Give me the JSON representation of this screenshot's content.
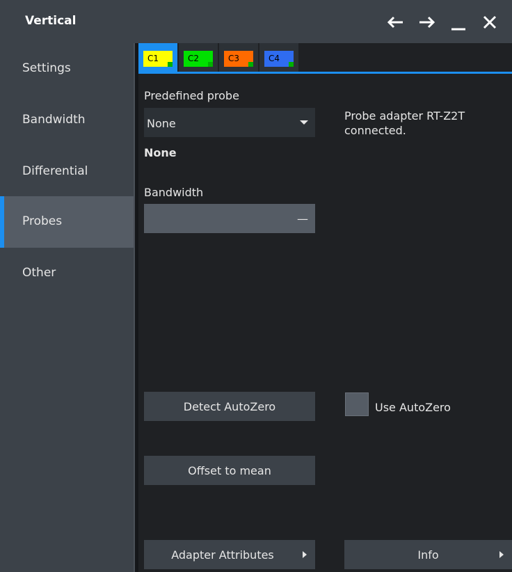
{
  "window": {
    "title": "Vertical",
    "controls": [
      "back-arrow-icon",
      "forward-arrow-icon",
      "minimize-icon",
      "close-icon"
    ]
  },
  "sidebar": {
    "items": [
      {
        "label": "Settings"
      },
      {
        "label": "Bandwidth"
      },
      {
        "label": "Differential"
      },
      {
        "label": "Probes",
        "active": true
      },
      {
        "label": "Other"
      }
    ],
    "accent_color": "#1c8ff0"
  },
  "tabs": [
    {
      "label": "C1",
      "color": "#ffff00",
      "active": true
    },
    {
      "label": "C2",
      "color": "#00e000"
    },
    {
      "label": "C3",
      "color": "#ff6a00"
    },
    {
      "label": "C4",
      "color": "#2f6cf0"
    }
  ],
  "probes": {
    "predefined_probe_label": "Predefined probe",
    "predefined_probe_value": "None",
    "probe_name": "None",
    "bandwidth_label": "Bandwidth",
    "bandwidth_value": "—",
    "adapter_message_line1": "Probe adapter RT-Z2T",
    "adapter_message_line2": "connected.",
    "detect_autozero_label": "Detect AutoZero",
    "use_autozero_label": "Use AutoZero",
    "use_autozero_checked": false,
    "offset_to_mean_label": "Offset to mean",
    "adapter_attributes_label": "Adapter Attributes",
    "info_label": "Info"
  }
}
